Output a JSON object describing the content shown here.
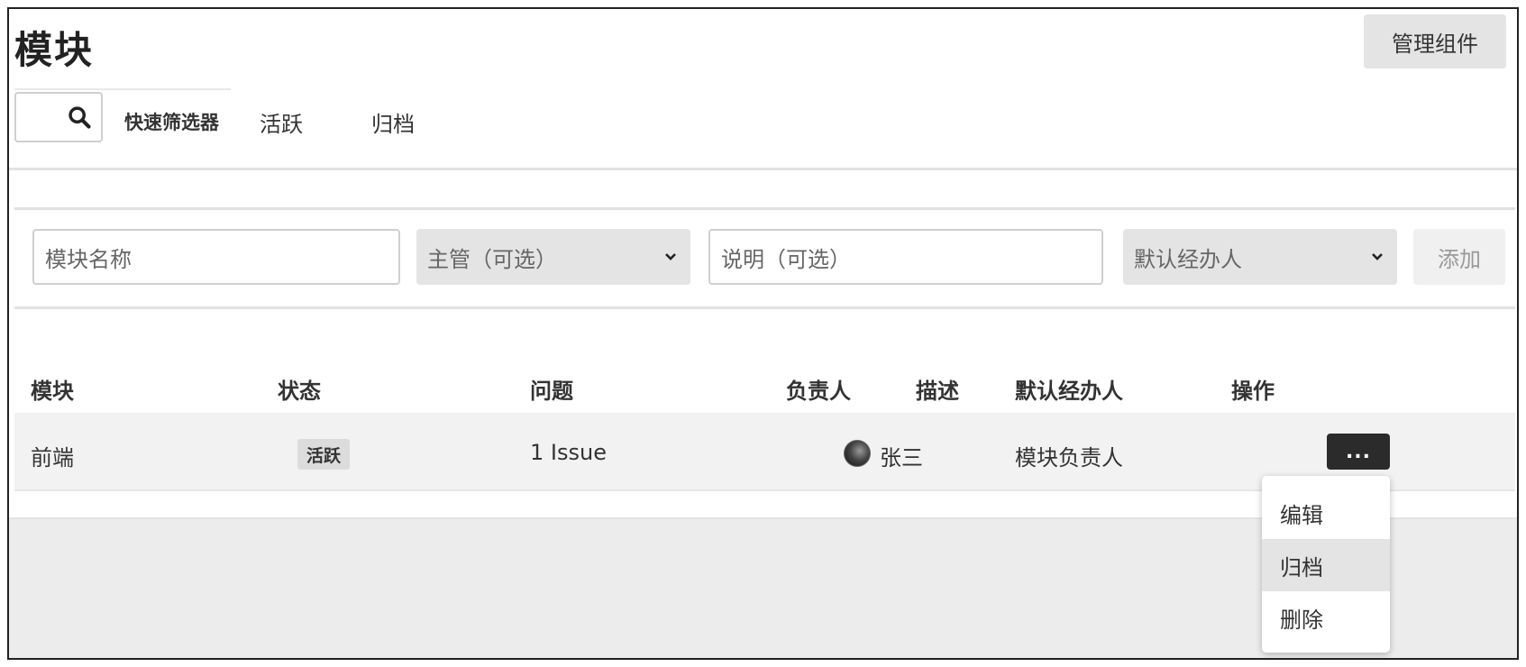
{
  "header": {
    "title": "模块",
    "manage_button": "管理组件"
  },
  "filters": {
    "search_icon": "search-icon",
    "quick_filter_label": "快速筛选器",
    "active": "活跃",
    "archived": "归档"
  },
  "form": {
    "name_placeholder": "模块名称",
    "lead_placeholder": "主管（可选）",
    "description_placeholder": "说明（可选）",
    "assignee_placeholder": "默认经办人",
    "add_button": "添加"
  },
  "table": {
    "headers": [
      "模块",
      "状态",
      "问题",
      "负责人",
      "描述",
      "默认经办人",
      "操作"
    ],
    "rows": [
      {
        "module": "前端",
        "status": "活跃",
        "issues": "1 Issue",
        "lead": "张三",
        "description": "",
        "default_assignee": "模块负责人",
        "actions": "..."
      }
    ]
  },
  "action_menu": {
    "items": [
      "编辑",
      "归档",
      "删除"
    ],
    "highlighted": "归档"
  }
}
